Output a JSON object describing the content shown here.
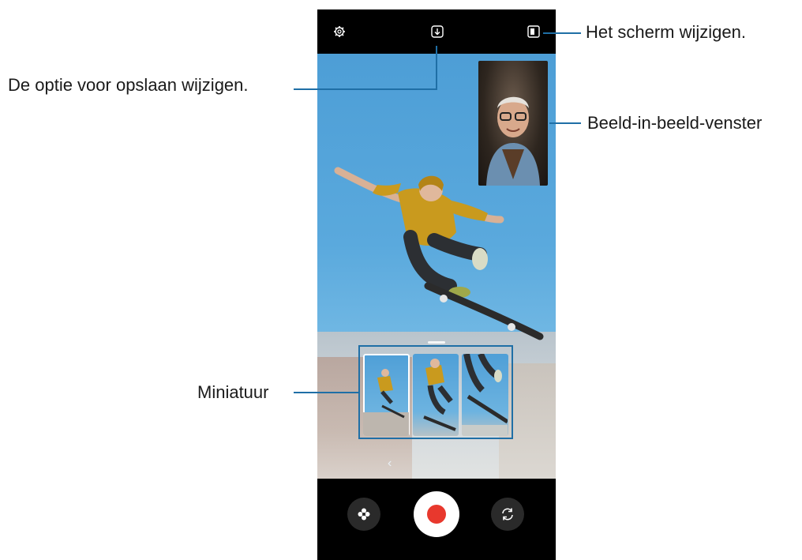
{
  "callouts": {
    "change_screen": "Het scherm wijzigen.",
    "save_option": "De optie voor opslaan wijzigen.",
    "pip_window": "Beeld-in-beeld-venster",
    "thumbnail": "Miniatuur"
  },
  "icons": {
    "settings": "gear-icon",
    "save_option": "download-icon",
    "change_screen": "pip-layout-icon",
    "effects": "flower-icon",
    "record": "record-button",
    "switch_camera": "rotate-icon",
    "collapse": "chevron-left-icon"
  },
  "colors": {
    "accent_line": "#1f6fa6",
    "record_red": "#e8382d",
    "bar_black": "#000000"
  },
  "thumbnails": {
    "count": 3,
    "selected_index": 0
  }
}
